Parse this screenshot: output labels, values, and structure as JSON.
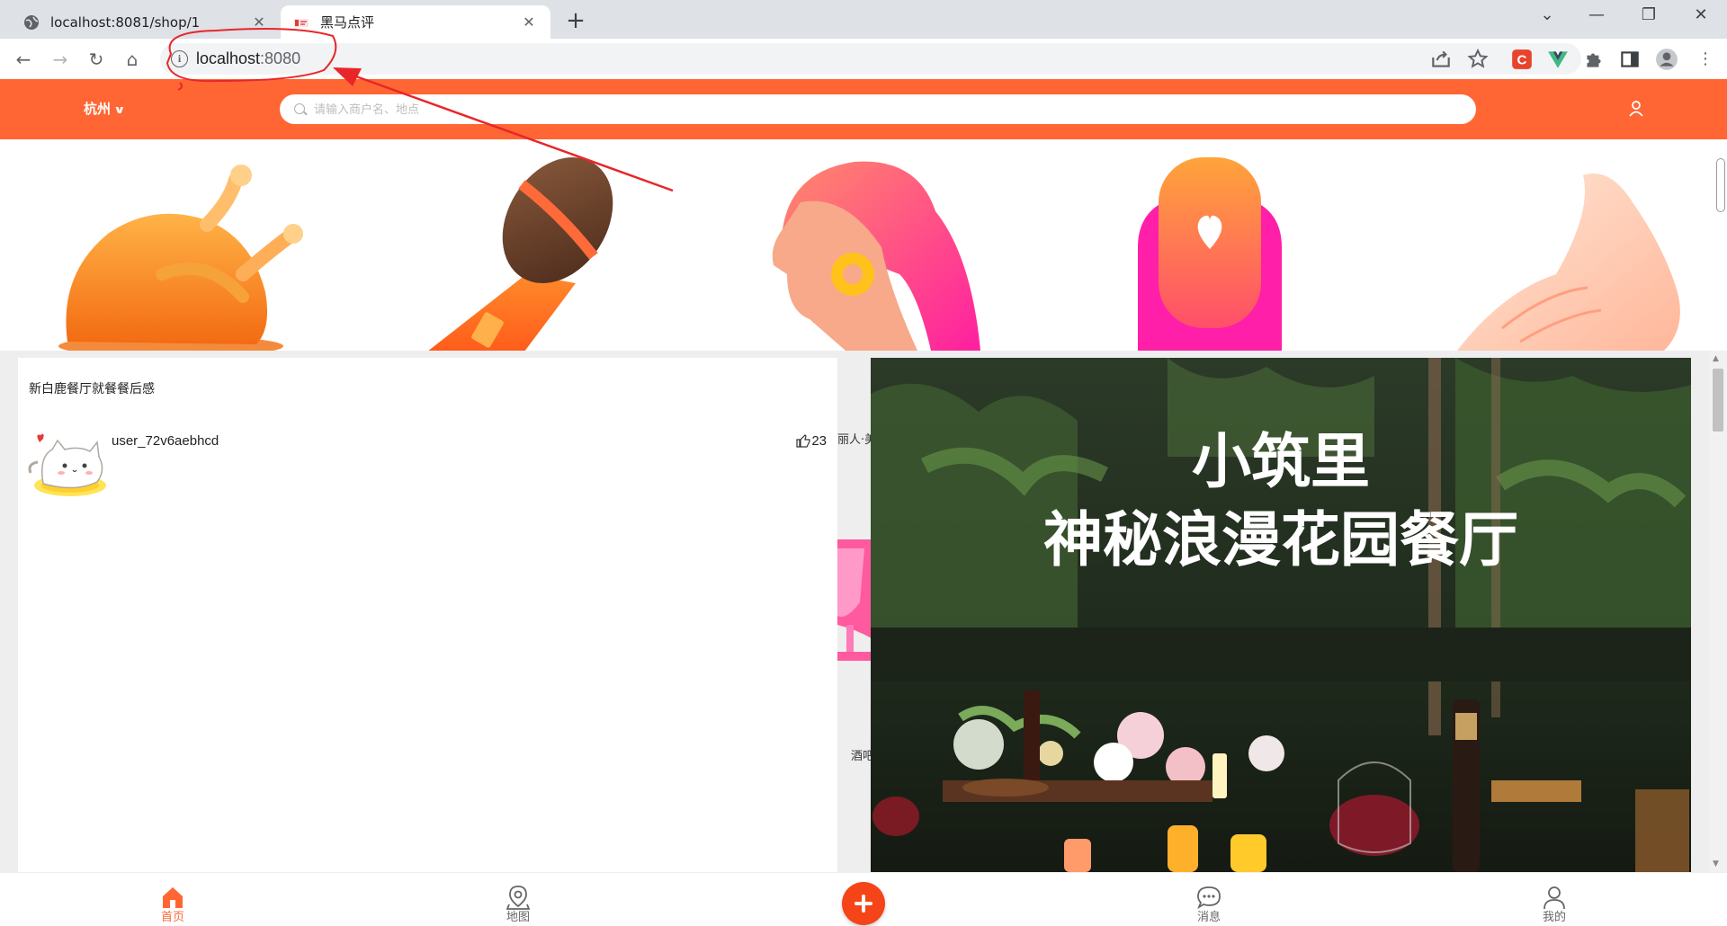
{
  "browser": {
    "tabs": [
      {
        "title": "localhost:8081/shop/1",
        "active": false
      },
      {
        "title": "黑马点评",
        "active": true
      }
    ],
    "address": {
      "host": "localhost",
      "port": ":8080"
    }
  },
  "app": {
    "accent_color": "#ff6633",
    "city": "杭州",
    "search_placeholder": "请输入商户名、地点",
    "categories": [
      {
        "icon": "roast-chicken-icon"
      },
      {
        "icon": "microphone-icon"
      },
      {
        "icon": "woman-hair-icon"
      },
      {
        "icon": "nail-heart-icon"
      },
      {
        "icon": "hand-massage-icon"
      }
    ],
    "blog_left": {
      "title": "新白鹿餐厅就餐餐后感",
      "username": "user_72v6aebhcd",
      "likes": "23"
    },
    "behind_labels": [
      "丽人·美",
      "酒吧"
    ],
    "blog_right": {
      "image_line1": "小筑里",
      "image_line2": "神秘浪漫花园餐厅"
    },
    "bottom_tabs": [
      {
        "label": "首页",
        "icon": "home-icon"
      },
      {
        "label": "地图",
        "icon": "map-pin-icon"
      },
      {
        "label": "",
        "icon": "plus-icon"
      },
      {
        "label": "消息",
        "icon": "message-icon"
      },
      {
        "label": "我的",
        "icon": "user-icon"
      }
    ]
  }
}
